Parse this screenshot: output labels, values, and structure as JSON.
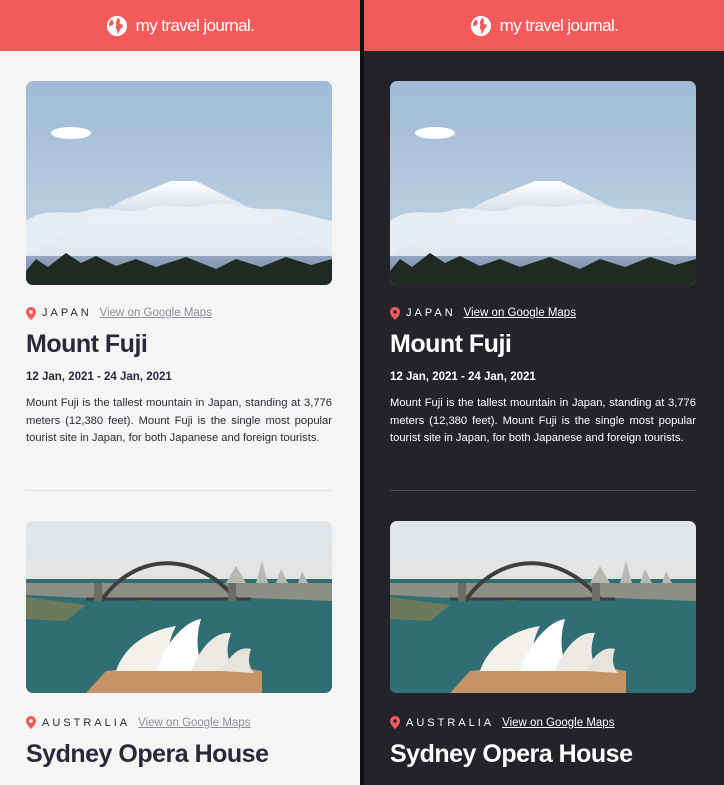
{
  "header": {
    "title": "my travel journal.",
    "icon": "globe-icon"
  },
  "theme": {
    "accent": "#f55a5a",
    "light_bg": "#f5f5f5",
    "dark_bg": "#24232a"
  },
  "entries": [
    {
      "country": "JAPAN",
      "maps_link": "View on Google Maps",
      "title": "Mount Fuji",
      "dates": "12 Jan, 2021 - 24 Jan, 2021",
      "description": "Mount Fuji is the tallest mountain in Japan, standing at 3,776 meters (12,380 feet). Mount Fuji is the single most popular tourist site in Japan, for both Japanese and foreign tourists."
    },
    {
      "country": "AUSTRALIA",
      "maps_link": "View on Google Maps",
      "title": "Sydney Opera House"
    }
  ]
}
